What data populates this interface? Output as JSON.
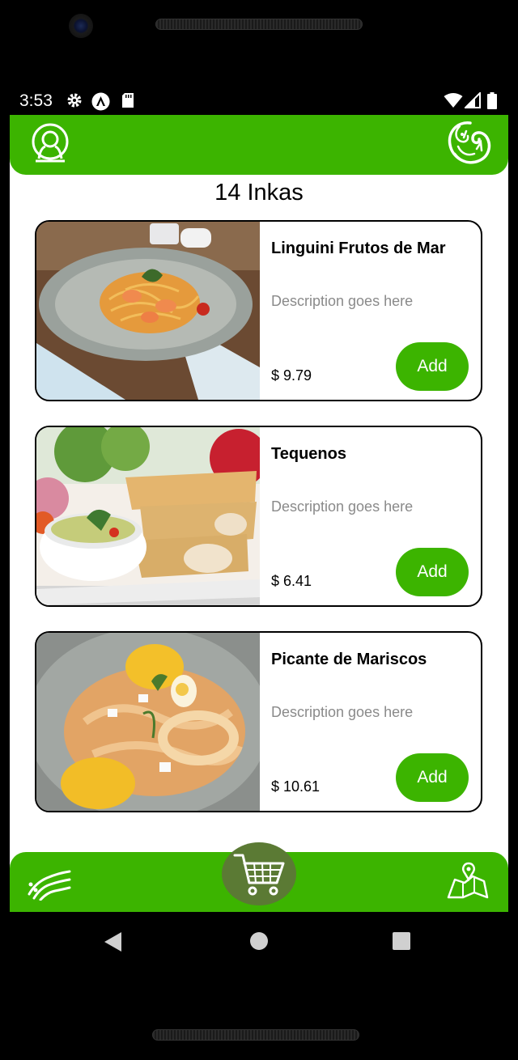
{
  "status_bar": {
    "time": "3:53"
  },
  "header": {
    "title": "14 Inkas"
  },
  "menu": {
    "items": [
      {
        "name": "Linguini Frutos de Mar",
        "description": "Description goes here",
        "price": "$ 9.79",
        "add_label": "Add"
      },
      {
        "name": "Tequenos",
        "description": "Description goes here",
        "price": "$ 6.41",
        "add_label": "Add"
      },
      {
        "name": "Picante de Mariscos",
        "description": "Description goes here",
        "price": "$ 10.61",
        "add_label": "Add"
      }
    ]
  },
  "colors": {
    "brand_green": "#3cb400",
    "cart_fab": "#5b7a34",
    "description_gray": "#8a8a8a"
  },
  "icons": {
    "top_left": "profile-icon",
    "top_right": "brand-logo-icon",
    "bottom_left": "wifi-icon",
    "bottom_center": "cart-icon",
    "bottom_right": "map-icon"
  }
}
